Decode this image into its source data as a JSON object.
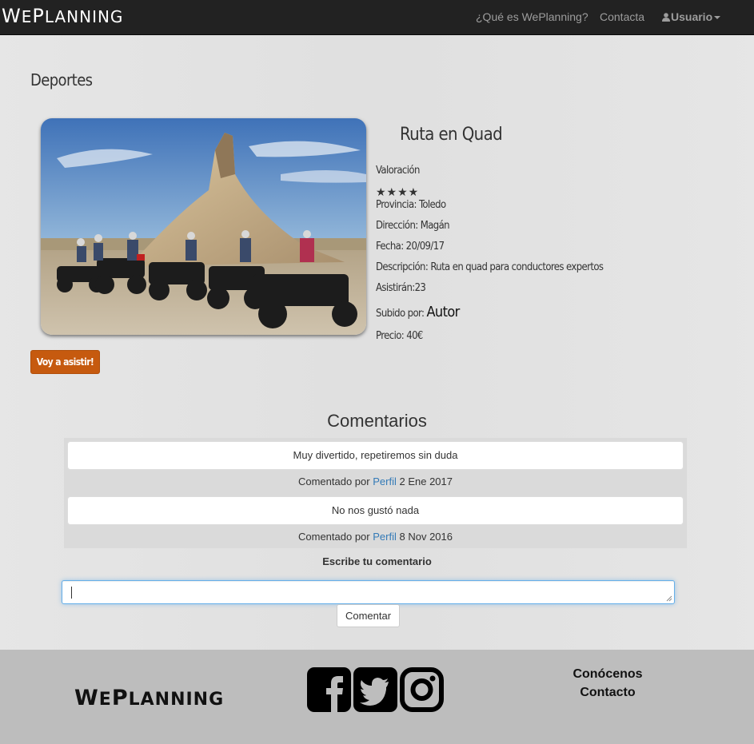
{
  "navbar": {
    "brand_first": "W",
    "brand_e": "E",
    "brand_p": "P",
    "brand_rest": "LANNING",
    "links": [
      "¿Qué es WePlanning?",
      "Contacta"
    ],
    "user_label": "Usuario"
  },
  "page": {
    "section": "Deportes"
  },
  "event": {
    "title": "Ruta en Quad",
    "rating_label": "Valoración",
    "stars": "★★★★",
    "rating_value": 4,
    "province": "Provincia: Toledo",
    "address": "Dirección: Magán",
    "date": "Fecha: 20/09/17",
    "description": "Descripción: Ruta en quad para conductores expertos",
    "attendees": "Asistirán:23",
    "uploaded_by_label": "Subido por:",
    "author": "Autor",
    "price": "Precio: 40€",
    "assist_button": "Voy a asistir!"
  },
  "comments": {
    "heading": "Comentarios",
    "items": [
      {
        "text": "Muy divertido, repetiremos sin duda",
        "by_label": "Comentado por",
        "profile": "Perfil",
        "date": "2 Ene 2017"
      },
      {
        "text": "No nos gustó nada",
        "by_label": "Comentado por",
        "profile": "Perfil",
        "date": "8 Nov 2016"
      }
    ],
    "write_label": "Escribe tu comentario",
    "input_value": "",
    "submit_label": "Comentar"
  },
  "footer": {
    "brand_first": "W",
    "brand_e": "E",
    "brand_p": "P",
    "brand_rest": "LANNING",
    "social_icons": [
      "facebook-icon",
      "twitter-icon",
      "instagram-icon"
    ],
    "links": [
      "Conócenos",
      "Contacto"
    ]
  },
  "colors": {
    "navbar_bg": "#222222",
    "accent_button": "#c65a0f",
    "link": "#337ab7",
    "footer_bg": "#bdbdbd"
  }
}
